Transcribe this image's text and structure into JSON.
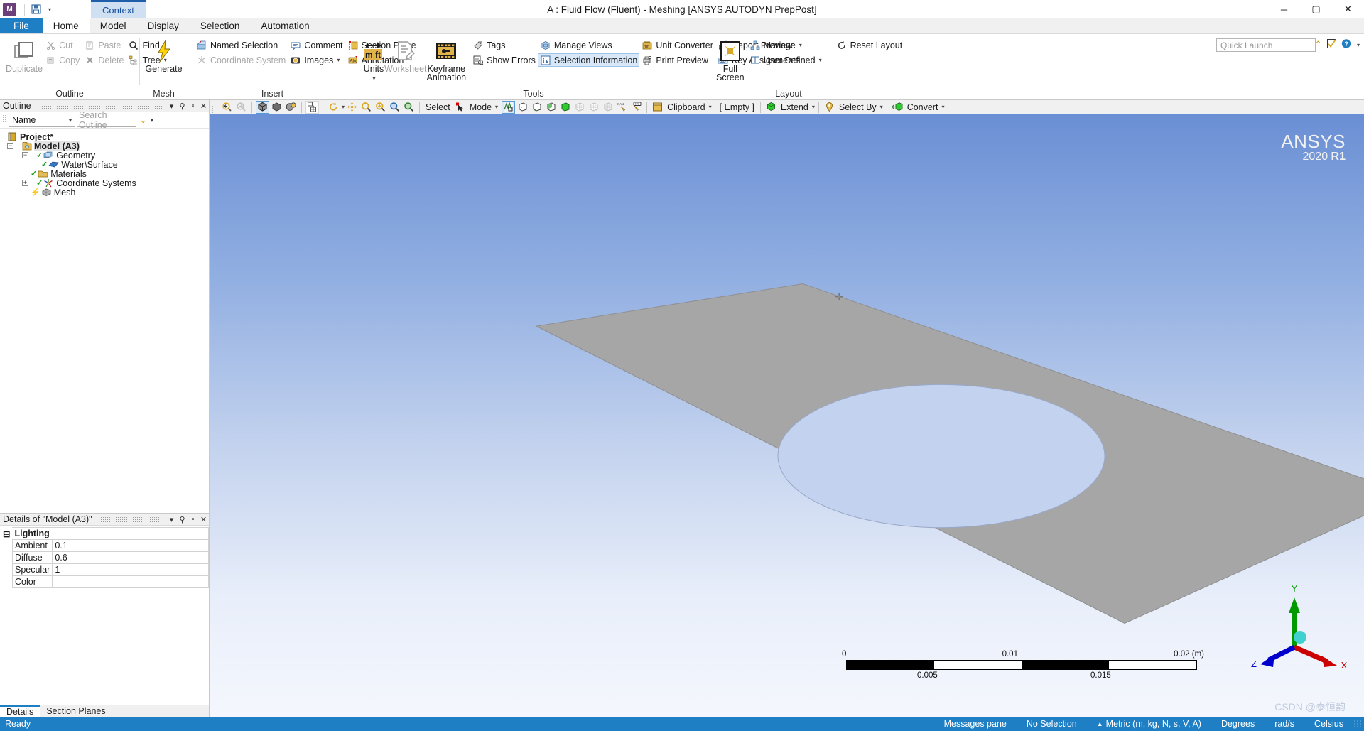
{
  "titlebar": {
    "app_icon_label": "M",
    "title": "A : Fluid Flow (Fluent) - Meshing [ANSYS AUTODYN PrepPost]",
    "save_icon": "save-icon",
    "qat_caret": "▾",
    "minimize": "─",
    "maximize": "▢",
    "close": "✕",
    "context_tab": "Context"
  },
  "ribbon_tabs": {
    "file": "File",
    "tabs": [
      {
        "label": "Home",
        "active": true
      },
      {
        "label": "Model",
        "active": false
      },
      {
        "label": "Display",
        "active": false
      },
      {
        "label": "Selection",
        "active": false
      },
      {
        "label": "Automation",
        "active": false
      }
    ]
  },
  "quick_launch": {
    "placeholder": "Quick Launch",
    "chevron_icon": "chevron-up-icon",
    "help_icon": "help-icon",
    "check_icon": "check-badge-icon"
  },
  "ribbon": {
    "groups": [
      {
        "name": "Outline",
        "label": "Outline",
        "big": {
          "label": "Duplicate",
          "icon": "duplicate-icon",
          "disabled": true
        },
        "small": [
          {
            "label": "Cut",
            "icon": "cut-icon",
            "disabled": true
          },
          {
            "label": "Copy",
            "icon": "copy-icon",
            "disabled": true
          },
          {
            "label": "Paste",
            "icon": "paste-icon",
            "disabled": true
          },
          {
            "label": "Delete",
            "icon": "delete-icon",
            "disabled": true
          },
          {
            "label": "Find",
            "icon": "find-icon",
            "disabled": false
          },
          {
            "label": "Tree",
            "icon": "tree-icon",
            "disabled": false,
            "caret": true
          }
        ]
      },
      {
        "name": "Mesh",
        "label": "Mesh",
        "big": {
          "label": "Generate",
          "icon": "lightning-icon",
          "disabled": false
        }
      },
      {
        "name": "Insert",
        "label": "Insert",
        "small": [
          {
            "label": "Named Selection",
            "icon": "named-selection-icon",
            "disabled": false
          },
          {
            "label": "Coordinate System",
            "icon": "coordinate-system-icon",
            "disabled": true
          },
          {
            "label": "Comment",
            "icon": "comment-icon",
            "disabled": false
          },
          {
            "label": "Images",
            "icon": "images-icon",
            "disabled": false,
            "caret": true
          },
          {
            "label": "Section Plane",
            "icon": "section-plane-icon",
            "disabled": false
          },
          {
            "label": "Annotation",
            "icon": "annotation-icon",
            "disabled": false
          }
        ]
      },
      {
        "name": "Tools",
        "label": "Tools",
        "bigs": [
          {
            "label": "Units",
            "icon": "units-icon",
            "disabled": false,
            "caret": true
          },
          {
            "label": "Worksheet",
            "icon": "worksheet-icon",
            "disabled": true
          },
          {
            "label": "Keyframe Animation",
            "icon": "keyframe-animation-icon",
            "disabled": false
          }
        ],
        "small": [
          {
            "label": "Tags",
            "icon": "tags-icon",
            "disabled": false
          },
          {
            "label": "Show Errors",
            "icon": "show-errors-icon",
            "disabled": false
          },
          {
            "label": "Manage Views",
            "icon": "manage-views-icon",
            "disabled": false
          },
          {
            "label": "Selection Information",
            "icon": "selection-information-icon",
            "disabled": false,
            "active": true
          },
          {
            "label": "Unit Converter",
            "icon": "unit-converter-icon",
            "disabled": false
          },
          {
            "label": "Print Preview",
            "icon": "print-preview-icon",
            "disabled": false
          },
          {
            "label": "Report Preview",
            "icon": "report-preview-icon",
            "disabled": false
          },
          {
            "label": "Key Assignments",
            "icon": "key-assignments-icon",
            "disabled": false
          }
        ]
      },
      {
        "name": "Layout",
        "label": "Layout",
        "big": {
          "label": "Full Screen",
          "icon": "full-screen-icon",
          "disabled": false
        },
        "small": [
          {
            "label": "Manage",
            "icon": "manage-icon",
            "disabled": false,
            "caret": true
          },
          {
            "label": "User Defined",
            "icon": "user-defined-icon",
            "disabled": false,
            "caret": true
          },
          {
            "label": "Reset Layout",
            "icon": "reset-layout-icon",
            "disabled": false
          }
        ]
      }
    ]
  },
  "outline_panel": {
    "header_title": "Outline",
    "pin_icon": "pin-icon",
    "restore_icon": "restore-icon",
    "close_icon": "close-icon",
    "dropdown_icon": "chevron-down-icon",
    "filter_value": "Name",
    "search_placeholder": "Search Outline",
    "tree": [
      {
        "label": "Project*",
        "indent": 0,
        "bold": true,
        "expander": "",
        "check": false,
        "icon": "project-icon"
      },
      {
        "label": "Model (A3)",
        "indent": 1,
        "bold": true,
        "expander": "−",
        "check": false,
        "icon": "model-icon",
        "highlight": true
      },
      {
        "label": "Geometry",
        "indent": 2,
        "bold": false,
        "expander": "−",
        "check": true,
        "icon": "geometry-icon"
      },
      {
        "label": "Water\\Surface",
        "indent": 3,
        "bold": false,
        "expander": "",
        "check": true,
        "icon": "surface-body-icon"
      },
      {
        "label": "Materials",
        "indent": 2,
        "bold": false,
        "expander": "",
        "check": true,
        "icon": "materials-icon"
      },
      {
        "label": "Coordinate Systems",
        "indent": 2,
        "bold": false,
        "expander": "+",
        "check": true,
        "icon": "coordinate-systems-icon"
      },
      {
        "label": "Mesh",
        "indent": 2,
        "bold": false,
        "expander": "",
        "check": false,
        "icon": "mesh-icon",
        "lightning": true
      }
    ]
  },
  "details_panel": {
    "header_title": "Details of \"Model (A3)\"",
    "pin_icon": "pin-icon",
    "restore_icon": "restore-icon",
    "close_icon": "close-icon",
    "dropdown_icon": "chevron-down-icon",
    "group": "Lighting",
    "rows": [
      {
        "key": "Ambient",
        "value": "0.1"
      },
      {
        "key": "Diffuse",
        "value": "0.6"
      },
      {
        "key": "Specular",
        "value": "1"
      },
      {
        "key": "Color",
        "value": ""
      }
    ]
  },
  "bottom_tabs": [
    {
      "label": "Details",
      "active": true
    },
    {
      "label": "Section Planes",
      "active": false
    }
  ],
  "graphics_toolbar": {
    "left_icons": [
      {
        "name": "zoom-previous-icon",
        "glyph": "⊖",
        "selected": false
      },
      {
        "name": "zoom-next-icon",
        "glyph": "⊕",
        "selected": false
      }
    ],
    "view_icons": [
      {
        "name": "isometric-view-icon",
        "selected": true
      },
      {
        "name": "shaded-view-icon",
        "selected": false
      },
      {
        "name": "wireframe-color-icon",
        "selected": false
      }
    ],
    "layout_icon": {
      "name": "graphics-layout-icon",
      "selected": false
    },
    "nav_icons": [
      {
        "name": "rotate-icon",
        "caret": true
      },
      {
        "name": "pan-icon"
      },
      {
        "name": "zoom-icon"
      },
      {
        "name": "box-zoom-icon"
      },
      {
        "name": "zoom-to-fit-icon"
      },
      {
        "name": "magnify-icon"
      }
    ],
    "select_label": "Select",
    "mode_label": "Mode",
    "pick_icons": [
      {
        "name": "single-select-icon",
        "selected": true
      },
      {
        "name": "vertex-select-icon",
        "selected": false
      },
      {
        "name": "edge-select-icon",
        "selected": false
      },
      {
        "name": "face-select-icon",
        "selected": false
      },
      {
        "name": "body-select-icon",
        "selected": false,
        "green": true
      },
      {
        "name": "node-select-icon",
        "disabled": true
      },
      {
        "name": "element-select-icon",
        "disabled": true
      },
      {
        "name": "element-face-select-icon",
        "disabled": true
      },
      {
        "name": "xyz-probe-icon"
      },
      {
        "name": "measure-probe-icon"
      }
    ],
    "clipboard_label": "Clipboard",
    "empty_label": "[ Empty ]",
    "extend_label": "Extend",
    "select_by_label": "Select By",
    "convert_label": "Convert"
  },
  "viewport": {
    "logo_line1": "ANSYS",
    "logo_line2_normal": "2020 ",
    "logo_line2_bold": "R1",
    "watermark": "CSDN @泰恒韵",
    "triad": {
      "x_label": "X",
      "y_label": "Y",
      "z_label": "Z",
      "x_color": "#cc0000",
      "y_color": "#009900",
      "z_color": "#0000cc",
      "origin_color": "#3fd0cf"
    },
    "scale_bar": {
      "top_labels": [
        "0",
        "0.01",
        "0.02 (m)"
      ],
      "bottom_labels": [
        "0.005",
        "0.015"
      ],
      "segments": [
        "#000000",
        "#ffffff",
        "#000000",
        "#ffffff"
      ]
    },
    "geometry_fill": "#a6a6a6",
    "hole_fill": "#c3d2ee"
  },
  "statusbar": {
    "ready": "Ready",
    "messages_pane": "Messages pane",
    "selection": "No Selection",
    "unit_system": "Metric (m, kg, N, s, V, A)",
    "angle": "Degrees",
    "rotation": "rad/s",
    "temperature": "Celsius",
    "unit_caret": "▲"
  }
}
